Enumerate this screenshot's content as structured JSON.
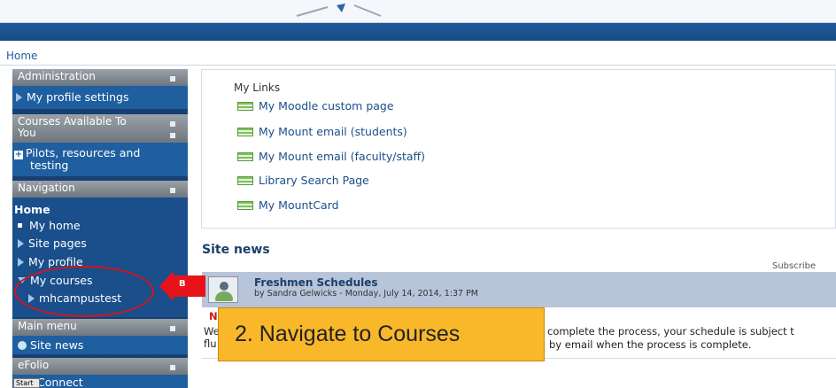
{
  "breadcrumb": {
    "home": "Home"
  },
  "sidebar": {
    "administration": {
      "title": "Administration",
      "items": [
        "My profile settings"
      ]
    },
    "courses_available": {
      "title_line1": "Courses Available To",
      "title_line2": "You",
      "items": [
        "Pilots, resources and",
        "testing"
      ]
    },
    "navigation": {
      "title": "Navigation",
      "home": "Home",
      "items": [
        "My home",
        "Site pages",
        "My profile",
        "My courses",
        "mhcampustest"
      ]
    },
    "main_menu": {
      "title": "Main menu",
      "items": [
        "Site news"
      ]
    },
    "efolio": {
      "title": "eFolio",
      "items": [
        "Connect"
      ]
    }
  },
  "my_links": {
    "title": "My Links",
    "items": [
      "My Moodle custom page",
      "My Mount email (students)",
      "My Mount email (faculty/staff)",
      "Library Search Page",
      "My MountCard"
    ]
  },
  "site_news": {
    "heading": "Site news",
    "subscribe": "Subscribe",
    "post": {
      "title": "Freshmen Schedules",
      "byline": "by Sandra Gelwicks - Monday, July 14, 2014, 1:37 PM",
      "line1_left": "N",
      "line2_left": "We",
      "line3_left": "flu",
      "line2_right": "complete the process, your schedule is subject t",
      "line3_right": "by email when the process is complete."
    }
  },
  "annotation": {
    "arrow_label": "B",
    "callout": "2. Navigate to Courses"
  },
  "taskbar": {
    "start": "Start"
  },
  "colors": {
    "sidebar": "#1f5fa0",
    "banner": "#174d86",
    "callout": "#f9b72a",
    "annotation_red": "#e8131a"
  }
}
